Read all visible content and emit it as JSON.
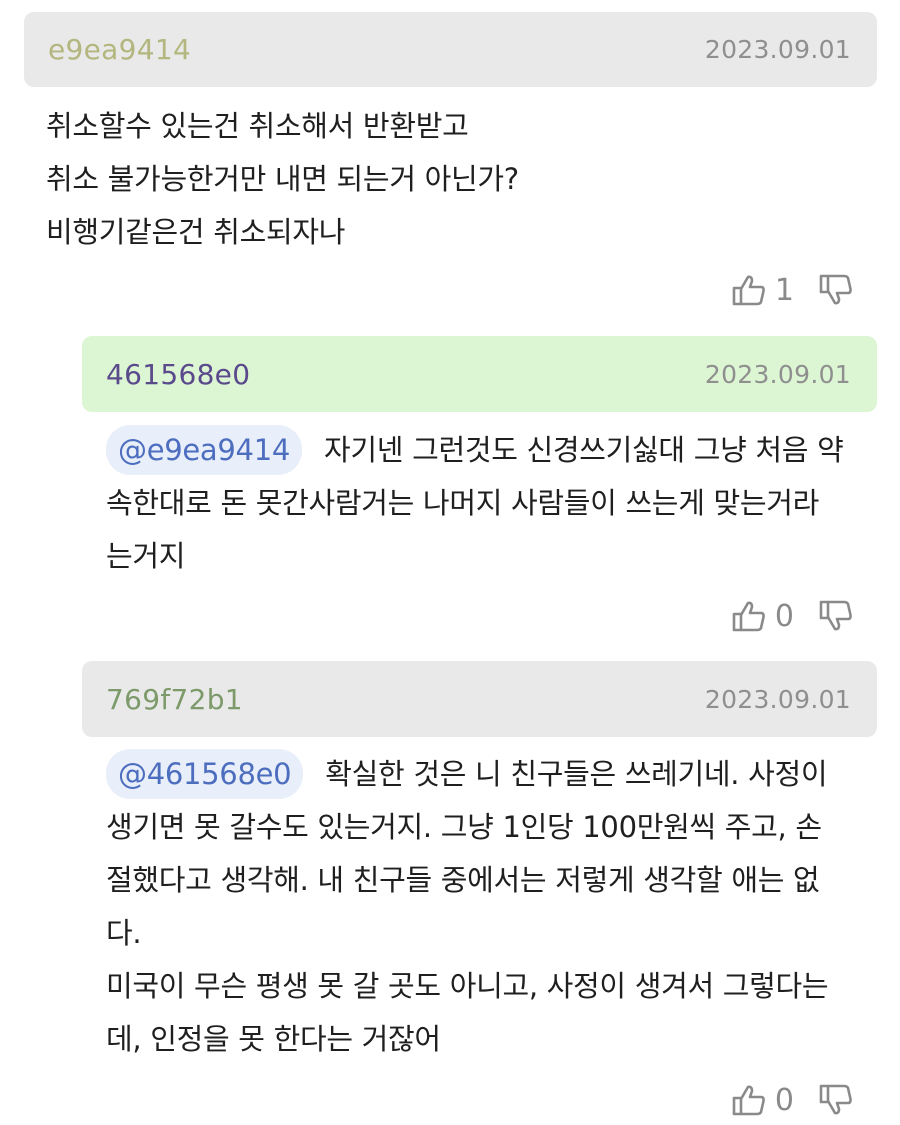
{
  "comments": [
    {
      "author": "e9ea9414",
      "author_color": "#b4b67f",
      "header_bg": "#e9e9e9",
      "date": "2023.09.01",
      "lines": [
        "취소할수 있는건 취소해서 반환받고",
        "취소 불가능한거만 내면 되는거 아닌가?",
        "비행기같은건 취소되자나"
      ],
      "likes": "1"
    },
    {
      "author": "461568e0",
      "author_color": "#5a4a8c",
      "header_bg": "#dcf5d3",
      "date": "2023.09.01",
      "mention": "@e9ea9414",
      "lines": [
        "자기넨 그런것도 신경쓰기싫대 그냥 처음 약",
        "속한대로 돈 못간사람거는 나머지 사람들이 쓰는게 맞는거라",
        "는거지"
      ],
      "likes": "0"
    },
    {
      "author": "769f72b1",
      "author_color": "#7d9a6a",
      "header_bg": "#e9e9e9",
      "date": "2023.09.01",
      "mention": "@461568e0",
      "lines": [
        "확실한 것은 니 친구들은 쓰레기네. 사정이",
        "생기면 못 갈수도 있는거지. 그냥 1인당 100만원씩 주고, 손",
        "절했다고 생각해. 내 친구들 중에서는 저렇게 생각할 애는 없",
        "다.",
        "미국이 무슨 평생 못 갈 곳도 아니고, 사정이 생겨서 그렇다는",
        "데, 인정을 못 한다는 거잖어"
      ],
      "likes": "0"
    }
  ]
}
